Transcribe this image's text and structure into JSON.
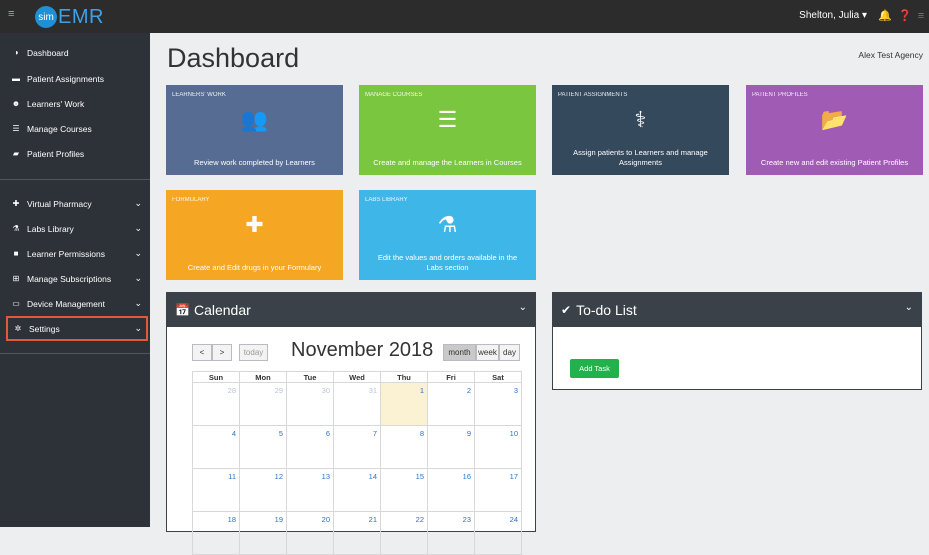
{
  "topbar": {
    "logo_sim": "sim",
    "logo_emr": "EMR",
    "user": "Shelton, Julia ▾"
  },
  "sidebar": {
    "items": [
      {
        "label": "Dashboard",
        "icon": "dashboard-icon",
        "glyph": "◑"
      },
      {
        "label": "Patient Assignments",
        "icon": "bed-icon",
        "glyph": "▬"
      },
      {
        "label": "Learners' Work",
        "icon": "group-icon",
        "glyph": "☻"
      },
      {
        "label": "Manage Courses",
        "icon": "list-icon",
        "glyph": "☰"
      },
      {
        "label": "Patient Profiles",
        "icon": "folder-open-icon",
        "glyph": "▰"
      },
      {
        "label": "Virtual Pharmacy",
        "icon": "medkit-icon",
        "glyph": "✚"
      },
      {
        "label": "Labs Library",
        "icon": "flask-icon",
        "glyph": "⚗"
      },
      {
        "label": "Learner Permissions",
        "icon": "lock-icon",
        "glyph": "■"
      },
      {
        "label": "Manage Subscriptions",
        "icon": "cart-icon",
        "glyph": "⊞"
      },
      {
        "label": "Device Management",
        "icon": "desktop-icon",
        "glyph": "▭"
      },
      {
        "label": "Settings",
        "icon": "gear-icon",
        "glyph": "✲"
      }
    ]
  },
  "main": {
    "title": "Dashboard",
    "agency": "Alex Test Agency",
    "tiles": [
      {
        "header": "LEARNERS' WORK",
        "text": "Review work completed by Learners",
        "color": "#566c93"
      },
      {
        "header": "MANAGE COURSES",
        "text": "Create and manage the Learners in Courses",
        "color": "#7bc63f"
      },
      {
        "header": "PATIENT ASSIGNMENTS",
        "text": "Assign patients to Learners and manage Assignments",
        "color": "#35495d"
      },
      {
        "header": "PATIENT PROFILES",
        "text": "Create new and edit existing Patient Profiles",
        "color": "#a05bb5"
      },
      {
        "header": "FORMULARY",
        "text": "Create and Edit drugs in your Formulary",
        "color": "#f5a623"
      },
      {
        "header": "LABS LIBRARY",
        "text": "Edit the values and orders available in the Labs section",
        "color": "#3eb7e8"
      }
    ]
  },
  "calendar": {
    "title": "Calendar",
    "month": "November 2018",
    "today_btn": "today",
    "views": [
      "month",
      "week",
      "day"
    ],
    "weekdays": [
      "Sun",
      "Mon",
      "Tue",
      "Wed",
      "Thu",
      "Fri",
      "Sat"
    ],
    "weeks": [
      [
        "28",
        "29",
        "30",
        "31",
        "1",
        "2",
        "3"
      ],
      [
        "4",
        "5",
        "6",
        "7",
        "8",
        "9",
        "10"
      ],
      [
        "11",
        "12",
        "13",
        "14",
        "15",
        "16",
        "17"
      ],
      [
        "18",
        "19",
        "20",
        "21",
        "22",
        "23",
        "24"
      ]
    ]
  },
  "todo": {
    "title": "To-do List",
    "add_task": "Add Task"
  }
}
